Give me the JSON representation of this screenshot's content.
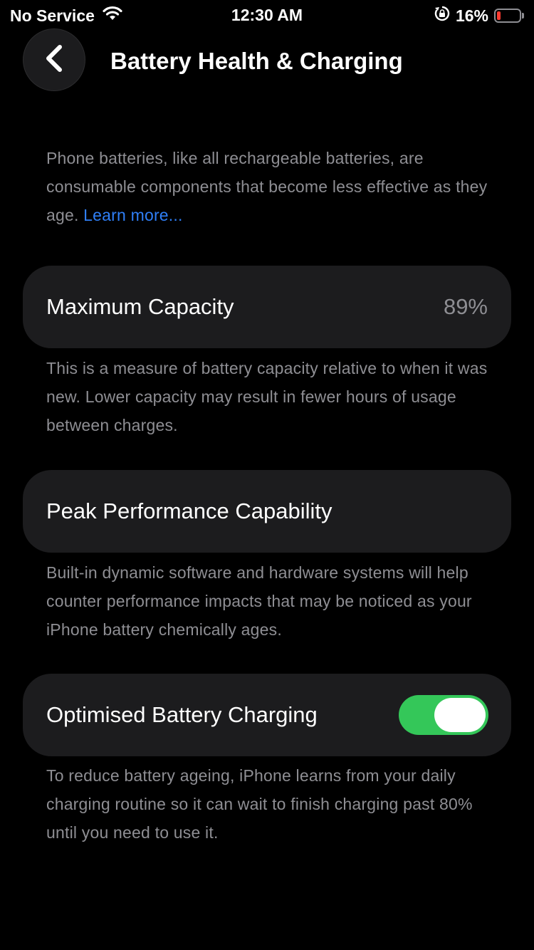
{
  "status_bar": {
    "carrier": "No Service",
    "time": "12:30 AM",
    "battery_percent_text": "16%",
    "battery_level": 0.16,
    "battery_color": "#ff3b30",
    "icons": [
      "wifi-icon",
      "orientation-lock-icon",
      "battery-icon"
    ]
  },
  "header": {
    "back_icon": "chevron-left-icon",
    "title": "Battery Health & Charging"
  },
  "intro": {
    "text": "Phone batteries, like all rechargeable batteries, are consumable components that become less effective as they age.",
    "link": "Learn more..."
  },
  "max_capacity": {
    "label": "Maximum Capacity",
    "value": "89%",
    "description": "This is a measure of battery capacity relative to when it was new. Lower capacity may result in fewer hours of usage between charges."
  },
  "peak_performance": {
    "label": "Peak Performance Capability",
    "description": "Built-in dynamic software and hardware systems will help counter performance impacts that may be noticed as your iPhone battery chemically ages."
  },
  "optimised_charging": {
    "label": "Optimised Battery Charging",
    "enabled": true,
    "toggle_color": "#34c759",
    "description": "To reduce battery ageing, iPhone learns from your daily charging routine so it can wait to finish charging past 80% until you need to use it."
  }
}
